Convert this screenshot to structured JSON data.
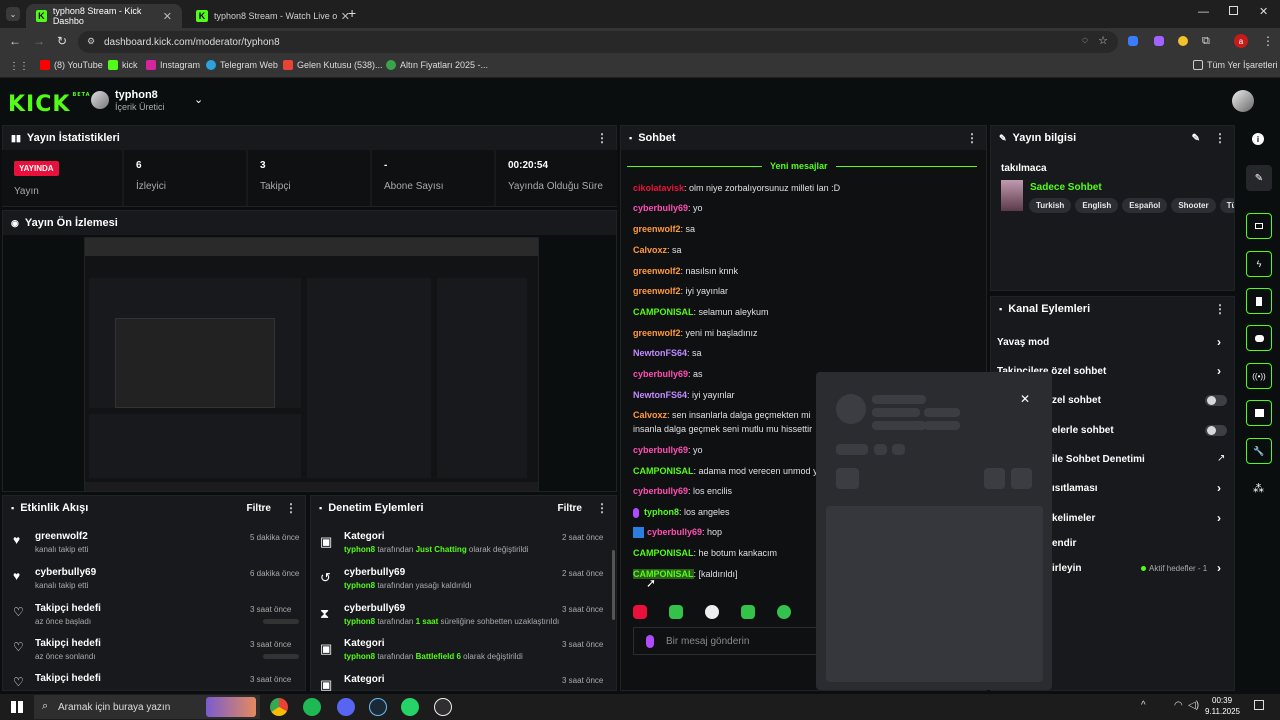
{
  "browser": {
    "tabs": [
      {
        "title": "typhon8 Stream - Kick Dashbo"
      },
      {
        "title": "typhon8 Stream - Watch Live o"
      }
    ],
    "url": "dashboard.kick.com/moderator/typhon8",
    "profile_initial": "a",
    "bookmarks": [
      "(8) YouTube",
      "kick",
      "Instagram",
      "Telegram Web",
      "Gelen Kutusu (538)...",
      "Altın Fiyatları 2025 -...",
      "Tüm Yer İşaretleri"
    ]
  },
  "header": {
    "logo": "KICK",
    "logo_beta": "BETA",
    "channel_name": "typhon8",
    "channel_role": "İçerik Üretici"
  },
  "stats": {
    "title": "Yayın İstatistikleri",
    "live_badge": "YAYINDA",
    "live_label": "Yayın",
    "viewers_value": "6",
    "viewers_label": "İzleyici",
    "followers_value": "3",
    "followers_label": "Takipçi",
    "subs_value": "-",
    "subs_label": "Abone Sayısı",
    "uptime_value": "00:20:54",
    "uptime_label": "Yayında Olduğu Süre"
  },
  "preview": {
    "title": "Yayın Ön İzlemesi"
  },
  "activity": {
    "title": "Etkinlik Akışı",
    "filter": "Filtre",
    "items": [
      {
        "name": "greenwolf2",
        "sub": "kanalı takip etti",
        "time": "5 dakika önce"
      },
      {
        "name": "cyberbully69",
        "sub": "kanalı takip etti",
        "time": "6 dakika önce"
      },
      {
        "name": "Takipçi hedefi",
        "sub": "az önce başladı",
        "time": "3 saat önce"
      },
      {
        "name": "Takipçi hedefi",
        "sub": "az önce sonlandı",
        "time": "3 saat önce"
      },
      {
        "name": "Takipçi hedefi",
        "sub": "",
        "time": "3 saat önce"
      }
    ]
  },
  "moderation": {
    "title": "Denetim Eylemleri",
    "filter": "Filtre",
    "items": [
      {
        "name": "Kategori",
        "actor": "typhon8",
        "pre": " tarafından ",
        "hl": "Just Chatting",
        "post": " olarak değiştirildi",
        "time": "2 saat önce"
      },
      {
        "name": "cyberbully69",
        "actor": "typhon8",
        "pre": " tarafından yasağı kaldırıldı",
        "hl": "",
        "post": "",
        "time": "2 saat önce"
      },
      {
        "name": "cyberbully69",
        "actor": "typhon8",
        "pre": " tarafından ",
        "hl": "1 saat",
        "post": " süreliğine sohbetten uzaklaştırıldı",
        "time": "3 saat önce"
      },
      {
        "name": "Kategori",
        "actor": "typhon8",
        "pre": " tarafından ",
        "hl": "Battlefield 6",
        "post": " olarak değiştirildi",
        "time": "3 saat önce"
      },
      {
        "name": "Kategori",
        "actor": "",
        "pre": "",
        "hl": "",
        "post": "",
        "time": "3 saat önce"
      }
    ]
  },
  "chat": {
    "title": "Sohbet",
    "new_messages": "Yeni mesajlar",
    "placeholder": "Bir mesaj gönderin",
    "messages": [
      {
        "user": "cikolatavisk",
        "color": "#e9113c",
        "text": ": olm niye zorbalıyorsunuz milleti lan :D"
      },
      {
        "user": "cyberbully69",
        "color": "#ff4fb4",
        "text": ": yo"
      },
      {
        "user": "greenwolf2",
        "color": "#ff9a3c",
        "text": ": sa"
      },
      {
        "user": "Calvoxz",
        "color": "#ff9a3c",
        "text": ": sa"
      },
      {
        "user": "greenwolf2",
        "color": "#ff9a3c",
        "text": ": nasılsın knnk"
      },
      {
        "user": "greenwolf2",
        "color": "#ff9a3c",
        "text": ": iyi yayınlar"
      },
      {
        "user": "CAMPONISAL",
        "color": "#53fc18",
        "text": ": selamun aleykum"
      },
      {
        "user": "greenwolf2",
        "color": "#ff9a3c",
        "text": ": yeni mi başladınız"
      },
      {
        "user": "NewtonFS64",
        "color": "#c18aff",
        "text": ": sa"
      },
      {
        "user": "cyberbully69",
        "color": "#ff4fb4",
        "text": ": as"
      },
      {
        "user": "NewtonFS64",
        "color": "#c18aff",
        "text": ": iyi yayınlar"
      },
      {
        "user": "Calvoxz",
        "color": "#ff9a3c",
        "text": ": sen insanlarla dalga geçmekten mi"
      },
      {
        "user": "",
        "color": "#e0e0e0",
        "text": "insanla dalga geçmek seni mutlu mu hissettir"
      },
      {
        "user": "cyberbully69",
        "color": "#ff4fb4",
        "text": ": yo"
      },
      {
        "user": "CAMPONISAL",
        "color": "#53fc18",
        "text": ": adama mod verecen unmod y"
      },
      {
        "user": "cyberbully69",
        "color": "#ff4fb4",
        "text": ": los encilis"
      },
      {
        "user": "typhon8",
        "color": "#53fc18",
        "text": ": los angeles"
      },
      {
        "user": "cyberbully69",
        "color": "#ff4fb4",
        "text": ": hop"
      },
      {
        "user": "CAMPONISAL",
        "color": "#53fc18",
        "text": ": he botum kankacım"
      },
      {
        "user": "CAMPONISAL",
        "color": "#53fc18",
        "text": ": [kaldırıldı]"
      }
    ]
  },
  "stream_info": {
    "title": "Yayın bilgisi",
    "stream_title": "takılmaca",
    "category": "Sadece Sohbet",
    "tags": [
      "Turkish",
      "English",
      "Español",
      "Shooter",
      "Tü"
    ]
  },
  "channel_actions": {
    "title": "Kanal Eylemleri",
    "items": [
      {
        "label": "Yavaş mod",
        "ctrl": "chevron"
      },
      {
        "label": "Takipçilere özel sohbet",
        "ctrl": "chevron"
      },
      {
        "label": "zel sohbet",
        "ctrl": "toggle"
      },
      {
        "label": "elerle sohbet",
        "ctrl": "toggle"
      },
      {
        "label": "ile Sohbet Denetimi",
        "ctrl": "ext"
      },
      {
        "label": "ısıtlaması",
        "ctrl": "chevron"
      },
      {
        "label": "kelimeler",
        "ctrl": "chevron"
      },
      {
        "label": "endir",
        "ctrl": "none"
      },
      {
        "label": "irleyin",
        "ctrl": "chevron"
      }
    ],
    "goals_status": "Aktif hedefler - 1"
  },
  "taskbar": {
    "search_placeholder": "Aramak için buraya yazın",
    "time": "00:39",
    "date": "9.11.2025"
  }
}
